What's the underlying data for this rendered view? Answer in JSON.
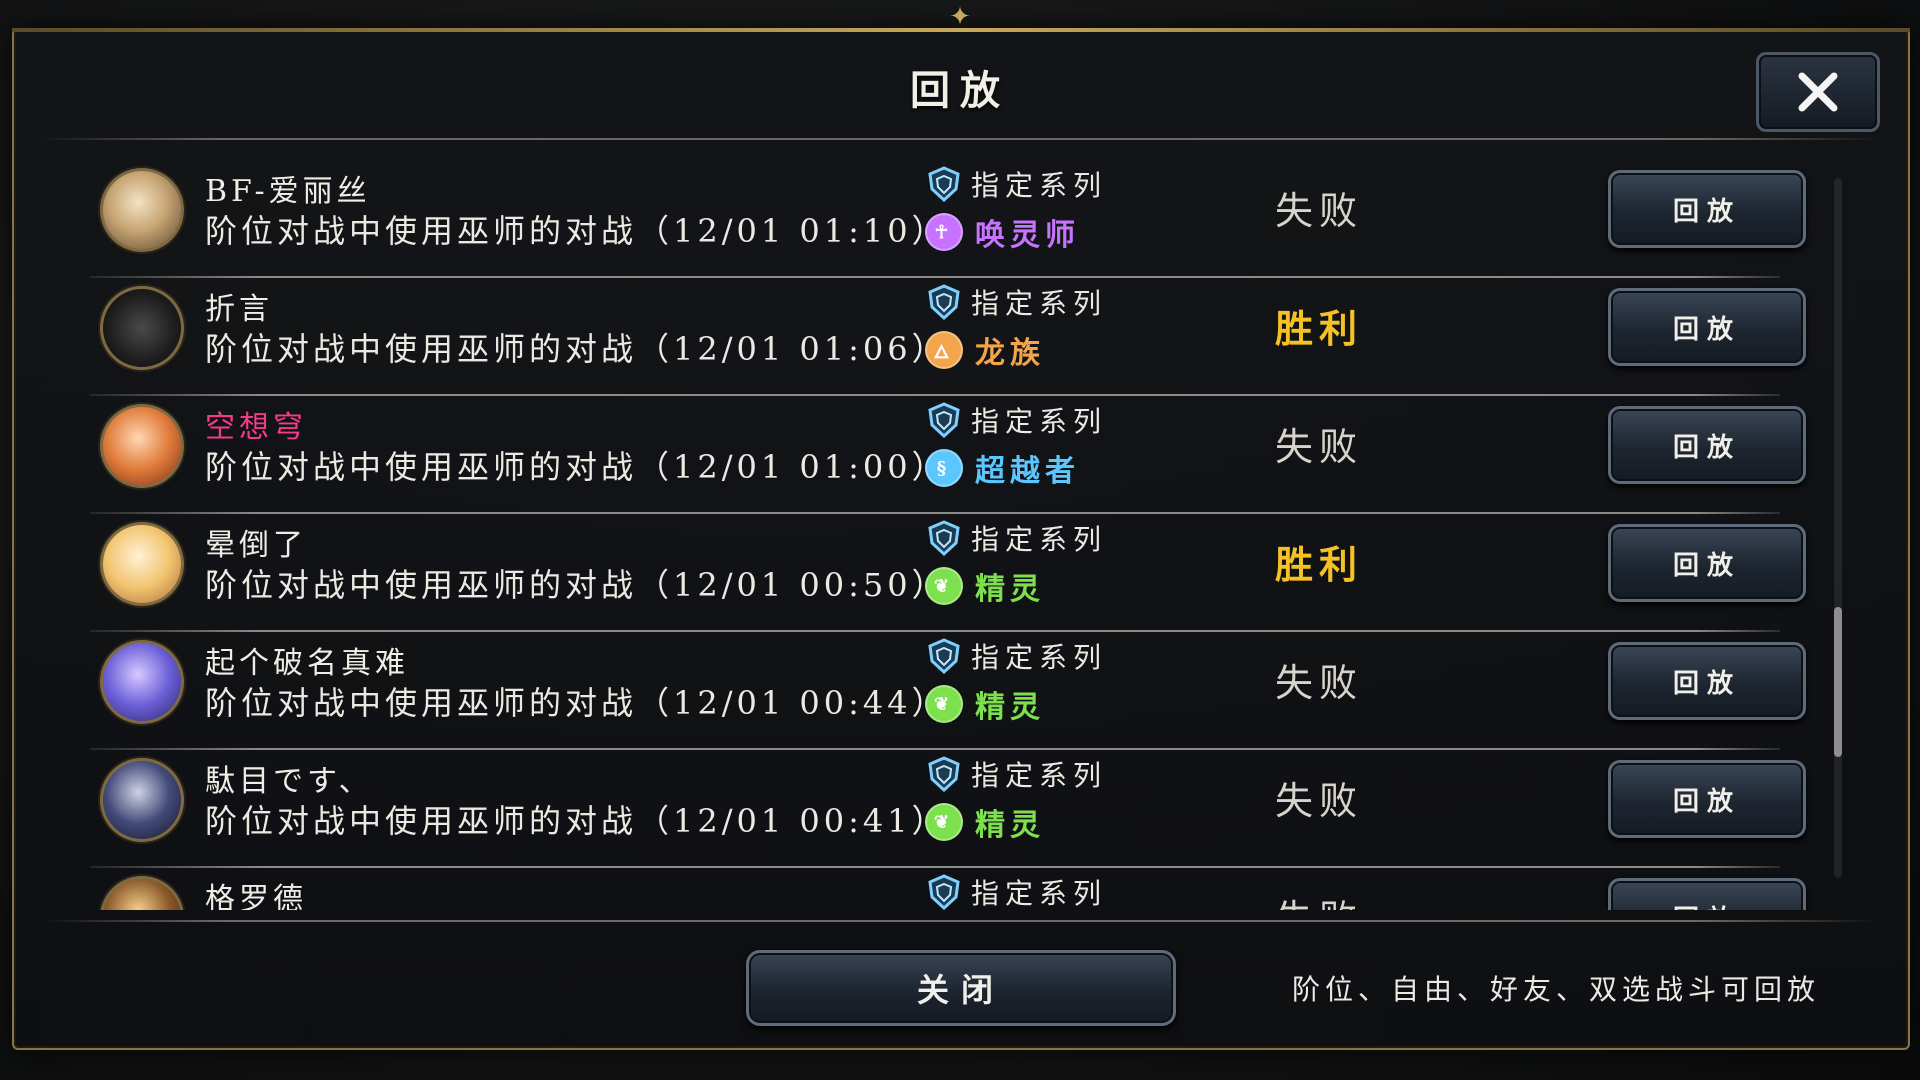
{
  "dialog": {
    "title": "回放",
    "close_button_label": "关闭",
    "hint": "阶位、自由、好友、双选战斗可回放"
  },
  "replays": [
    {
      "player": "BF-爱丽丝",
      "name_color": "#f0ede6",
      "description": "阶位对战中使用巫师的对战（12/01 01:10）",
      "series": "指定系列",
      "class_name": "唤灵师",
      "class_color": "#c873ff",
      "class_icon": "necromancer-icon",
      "result": "失败",
      "replay_label": "回放"
    },
    {
      "player": "折言",
      "name_color": "#f0ede6",
      "description": "阶位对战中使用巫师的对战（12/01 01:06）",
      "series": "指定系列",
      "class_name": "龙族",
      "class_color": "#f2a54a",
      "class_icon": "dragon-icon",
      "result": "胜利",
      "replay_label": "回放"
    },
    {
      "player": "空想穹",
      "name_color": "#f23c8a",
      "description": "阶位对战中使用巫师的对战（12/01 01:00）",
      "series": "指定系列",
      "class_name": "超越者",
      "class_color": "#5cc7ff",
      "class_icon": "transcendent-icon",
      "result": "失败",
      "replay_label": "回放"
    },
    {
      "player": "晕倒了",
      "name_color": "#f0ede6",
      "description": "阶位对战中使用巫师的对战（12/01 00:50）",
      "series": "指定系列",
      "class_name": "精灵",
      "class_color": "#7de04d",
      "class_icon": "leaf-icon",
      "result": "胜利",
      "replay_label": "回放"
    },
    {
      "player": "起个破名真难",
      "name_color": "#f0ede6",
      "description": "阶位对战中使用巫师的对战（12/01 00:44）",
      "series": "指定系列",
      "class_name": "精灵",
      "class_color": "#7de04d",
      "class_icon": "leaf-icon",
      "result": "失败",
      "replay_label": "回放"
    },
    {
      "player": "駄目です、",
      "name_color": "#f0ede6",
      "description": "阶位对战中使用巫师的对战（12/01 00:41）",
      "series": "指定系列",
      "class_name": "精灵",
      "class_color": "#7de04d",
      "class_icon": "leaf-icon",
      "result": "失败",
      "replay_label": "回放"
    },
    {
      "player": "格罗德",
      "name_color": "#f0ede6",
      "description": "",
      "series": "指定系列",
      "class_name": "",
      "class_color": "#7de04d",
      "class_icon": "",
      "result": "失败",
      "replay_label": "回放"
    }
  ],
  "scrollbar": {
    "position_fraction": 0.78
  },
  "colors": {
    "win": "#f6c223",
    "loss": "#d8d4cb",
    "frame_gold": "#8a7444",
    "button_border": "#5d6b7b"
  }
}
